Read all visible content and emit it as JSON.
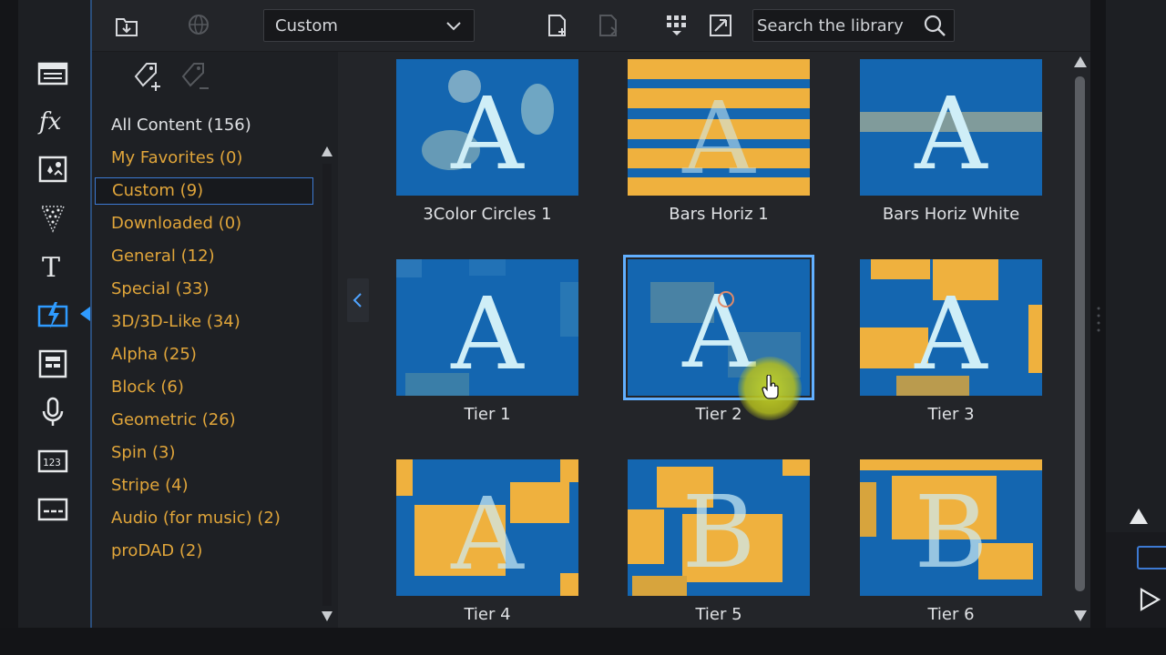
{
  "toolbar": {
    "category_dropdown": "Custom",
    "search_placeholder": "Search the library"
  },
  "categories": [
    {
      "label": "All Content (156)"
    },
    {
      "label": "My Favorites  (0)"
    },
    {
      "label": "Custom  (9)"
    },
    {
      "label": "Downloaded  (0)"
    },
    {
      "label": "General  (12)"
    },
    {
      "label": "Special  (33)"
    },
    {
      "label": "3D/3D-Like  (34)"
    },
    {
      "label": "Alpha  (25)"
    },
    {
      "label": "Block  (6)"
    },
    {
      "label": "Geometric  (26)"
    },
    {
      "label": "Spin  (3)"
    },
    {
      "label": "Stripe  (4)"
    },
    {
      "label": "Audio (for music)  (2)"
    },
    {
      "label": "proDAD  (2)"
    }
  ],
  "selected_category_index": 2,
  "transitions": [
    {
      "name": "3Color Circles 1",
      "preview_letter": "A"
    },
    {
      "name": "Bars Horiz 1",
      "preview_letter": "A"
    },
    {
      "name": "Bars Horiz White",
      "preview_letter": "A"
    },
    {
      "name": "Tier 1",
      "preview_letter": "A"
    },
    {
      "name": "Tier 2",
      "preview_letter": "A"
    },
    {
      "name": "Tier 3",
      "preview_letter": "A"
    },
    {
      "name": "Tier 4",
      "preview_letter": "A"
    },
    {
      "name": "Tier 5",
      "preview_letter": "B"
    },
    {
      "name": "Tier 6",
      "preview_letter": "B"
    }
  ],
  "selected_transition_index": 4,
  "colors": {
    "accent": "#2f9bff",
    "selection_outline": "#62b0ff",
    "category_text": "#e0a53a",
    "preview_blue": "#1466b0",
    "preview_gold": "#efb13e",
    "preview_letter": "#cfeef7"
  },
  "rail_icons": [
    "media-room-icon",
    "fx-icon",
    "pip-objects-icon",
    "particle-icon",
    "title-icon",
    "transition-icon",
    "menu-designer-icon",
    "voiceover-icon",
    "chapter-icon",
    "subtitle-icon"
  ],
  "toolbar_icons": [
    "import-icon",
    "download-globe-icon",
    "add-to-timeline-icon",
    "remove-icon",
    "grid-view-icon",
    "enlarge-icon",
    "search-icon"
  ]
}
